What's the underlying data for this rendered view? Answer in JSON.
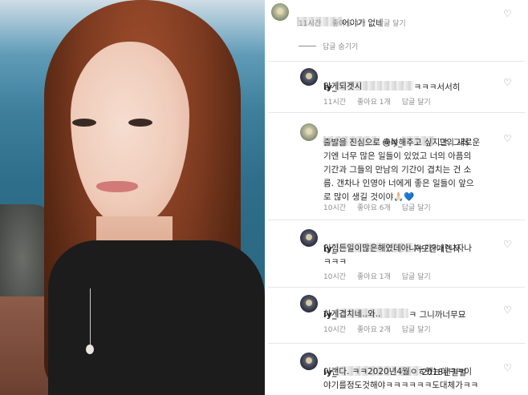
{
  "comments": [
    {
      "suffix": "어이가 없네",
      "meta": {
        "time": "11시간",
        "likes": "좋아요 4개",
        "reply": "답글 달기"
      }
    },
    {
      "user": "iy_",
      "line1": "ㅋㅋㅋ서서히",
      "line2": "알게되겟시",
      "meta": {
        "time": "11시간",
        "likes": "좋아요 1개",
        "reply": "답글 달기"
      }
    },
    {
      "mention": "@iy_",
      "line1": "그의 새로운",
      "line2": "출발을 진심으로 축복해주고 싶지만, 그러",
      "line3": "기엔 너무 많은 일들이 있었고 너의 아픔의",
      "line4": "기간과 그들의 만남의 기간이 겹치는 건 소",
      "line5": "름. 갠차나 인영아 너에게 좋은 일들이 앞으",
      "line6": "로 많이 생길 것이야🙏🏻💙",
      "meta": {
        "time": "10시간",
        "likes": "좋아요 6개",
        "reply": "답글 달기"
      }
    },
    {
      "user": "iy_",
      "line1": "저또한개인적",
      "line2": "인힘든일이많은해였데아니누가?나?나자나",
      "line3": "ㅋㅋㅋ",
      "meta": {
        "time": "10시간",
        "likes": "좋아요 1개",
        "reply": "답글 달기"
      }
    },
    {
      "user": "iy_",
      "line1": "ㅋ 그니까너무묘",
      "line2": "하게겹치네..와..",
      "meta": {
        "time": "10시간",
        "likes": "좋아요 2개",
        "reply": "답글 달기"
      }
    },
    {
      "user": "iy_",
      "line1": "2018년결별",
      "line2": "이랜다. ㅋㅋ2020년4월ㅇㅎ했는데ㅋㅋ이",
      "line3": "야기를정도것해야ㅋㅋㅋㅋㅋㅋ도대체가ㅋㅋ"
    }
  ],
  "replies_toggle": "답글 숨기기",
  "icons": {
    "like": "heart-outline-icon"
  }
}
